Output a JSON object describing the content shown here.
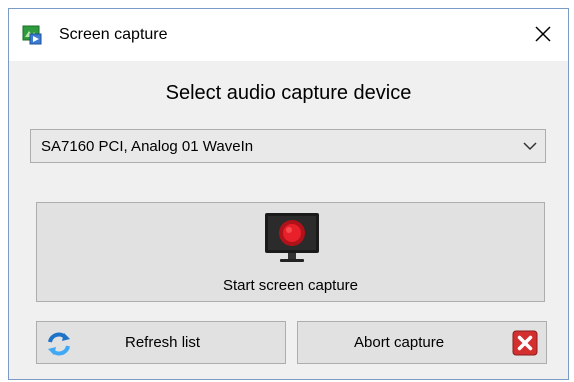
{
  "window": {
    "title": "Screen capture",
    "icon": "screen-capture-app-icon",
    "close_icon": "close-icon"
  },
  "main": {
    "heading": "Select audio capture device",
    "device_select": {
      "selected_value": "SA7160 PCI, Analog 01 WaveIn",
      "icon": "chevron-down-icon"
    },
    "start_button": {
      "label": "Start screen capture",
      "icon": "monitor-record-icon"
    },
    "refresh_button": {
      "label": "Refresh list",
      "icon": "refresh-icon"
    },
    "abort_button": {
      "label": "Abort capture",
      "icon": "red-x-icon"
    }
  },
  "colors": {
    "window_bg": "#f0f0f0",
    "button_bg": "#e1e1e1",
    "button_border": "#adadad",
    "record_red": "#e8202a",
    "abort_red": "#d32f2f",
    "refresh_blue": "#1e73c8"
  }
}
